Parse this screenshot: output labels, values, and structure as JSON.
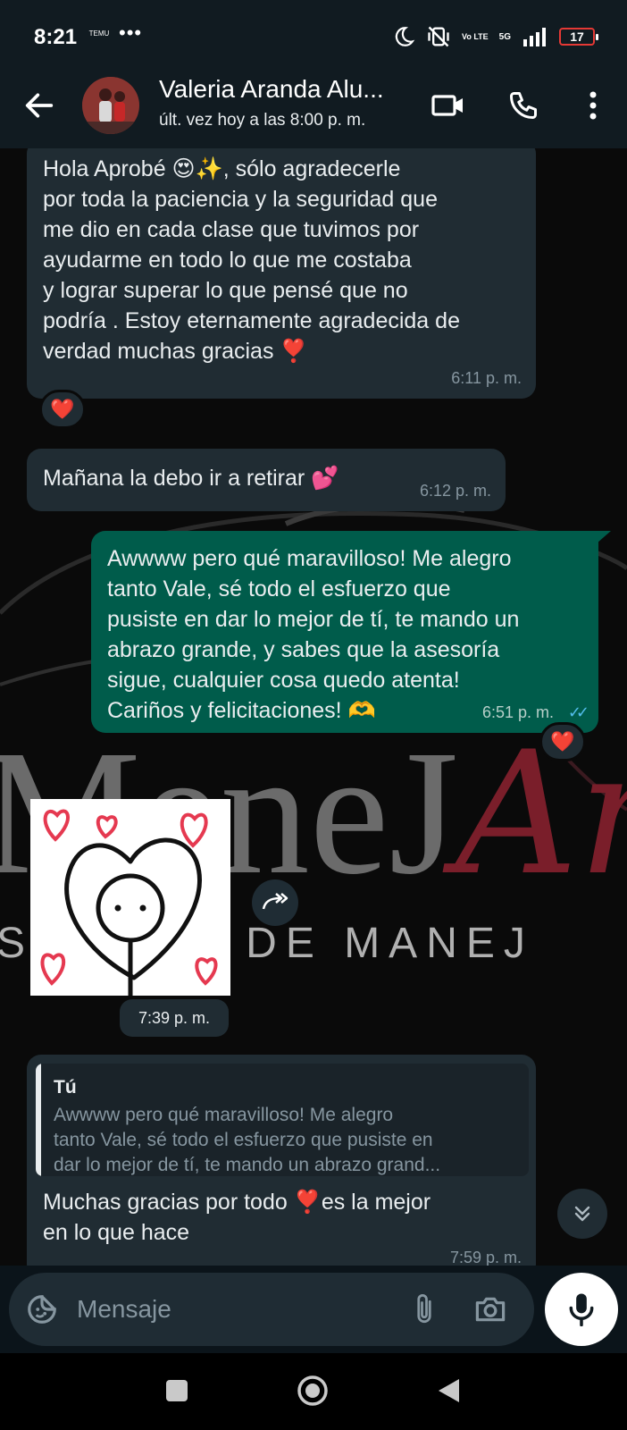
{
  "status_bar": {
    "time": "8:21",
    "temu_label": "TEMU",
    "dots": "•••",
    "vo_label": "Vo LTE",
    "network": "5G",
    "battery": "17"
  },
  "header": {
    "contact_name": "Valeria Aranda Alu...",
    "last_seen": "últ. vez hoy a las 8:00 p. m."
  },
  "wallpaper": {
    "brand_gray": "MeneJ",
    "brand_red": "Art",
    "tagline": "S       TICAS DE MANEJ"
  },
  "messages": [
    {
      "lines": [
        "Hola Aprobé 😍✨, sólo agradecerle",
        "por toda la paciencia y la seguridad que",
        "me dio en cada clase que tuvimos por",
        "ayudarme en todo lo que me costaba",
        "y lograr superar lo que pensé que no",
        "podría . Estoy eternamente agradecida de",
        "verdad muchas gracias ❣️"
      ],
      "time": "6:11 p. m.",
      "reaction": "❤️"
    },
    {
      "text": "Mañana la debo ir a retirar 💕",
      "time": "6:12 p. m."
    },
    {
      "lines": [
        "Awwww pero qué maravilloso! Me alegro",
        "tanto Vale, sé todo el esfuerzo que",
        "pusiste en dar lo mejor de tí, te mando un",
        "abrazo grande, y sabes que la asesoría",
        "sigue, cualquier cosa quedo atenta!",
        "Cariños y felicitaciones! 🫶"
      ],
      "time": "6:51 p. m.",
      "ticks": "✓✓",
      "reaction": "❤️"
    },
    {
      "time": "7:39 p. m."
    },
    {
      "quote_author": "Tú",
      "quote_lines": [
        "Awwww pero qué maravilloso! Me alegro",
        "tanto Vale, sé todo el esfuerzo que pusiste en",
        "dar lo mejor de tí, te mando un abrazo grand..."
      ],
      "lines": [
        "Muchas gracias por todo ❣️es la mejor",
        "en lo que hace"
      ],
      "time": "7:59 p. m."
    }
  ],
  "composer": {
    "placeholder": "Mensaje"
  },
  "colors": {
    "incoming_bubble": "#202c33",
    "outgoing_bubble": "#005c4b",
    "header_bg": "#111b21",
    "read_ticks": "#53bdeb",
    "brand_red": "#7a1e2a"
  }
}
